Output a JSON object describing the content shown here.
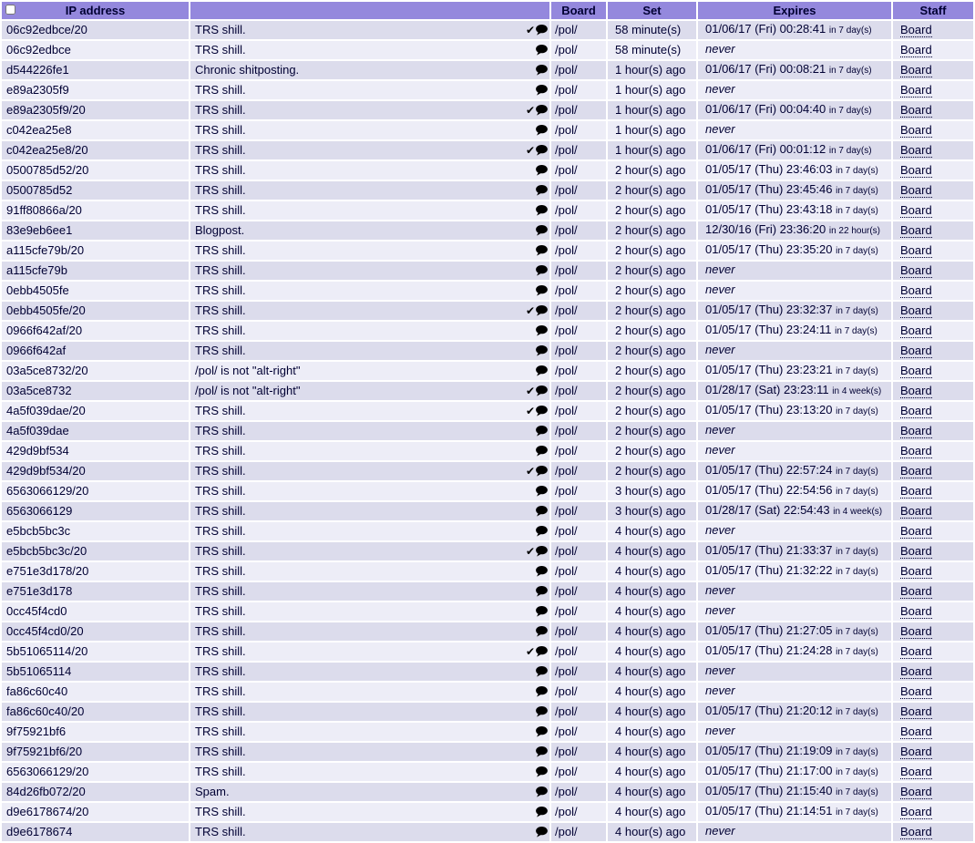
{
  "colors": {
    "header_bg": "#9488dd",
    "row_odd": "#dcdcec",
    "row_even": "#ededf7",
    "text": "#000033",
    "page_bg": "#ffffff"
  },
  "table": {
    "columns": [
      "IP address",
      "",
      "Board",
      "Set",
      "Expires",
      "Staff"
    ],
    "select_all_checked": false
  },
  "icons": {
    "seen_check": "checkmark-icon",
    "message": "speech-bubble-icon"
  },
  "rows": [
    {
      "ip": "06c92edbce/20",
      "reason": "TRS shill.",
      "check": true,
      "board": "/pol/",
      "set": "58 minute(s)",
      "expires": "01/06/17 (Fri) 00:28:41",
      "note": "in 7 day(s)",
      "staff": "Board"
    },
    {
      "ip": "06c92edbce",
      "reason": "TRS shill.",
      "check": false,
      "board": "/pol/",
      "set": "58 minute(s)",
      "expires": "never",
      "note": "",
      "staff": "Board"
    },
    {
      "ip": "d544226fe1",
      "reason": "Chronic shitposting.",
      "check": false,
      "board": "/pol/",
      "set": "1 hour(s) ago",
      "expires": "01/06/17 (Fri) 00:08:21",
      "note": "in 7 day(s)",
      "staff": "Board"
    },
    {
      "ip": "e89a2305f9",
      "reason": "TRS shill.",
      "check": false,
      "board": "/pol/",
      "set": "1 hour(s) ago",
      "expires": "never",
      "note": "",
      "staff": "Board"
    },
    {
      "ip": "e89a2305f9/20",
      "reason": "TRS shill.",
      "check": true,
      "board": "/pol/",
      "set": "1 hour(s) ago",
      "expires": "01/06/17 (Fri) 00:04:40",
      "note": "in 7 day(s)",
      "staff": "Board"
    },
    {
      "ip": "c042ea25e8",
      "reason": "TRS shill.",
      "check": false,
      "board": "/pol/",
      "set": "1 hour(s) ago",
      "expires": "never",
      "note": "",
      "staff": "Board"
    },
    {
      "ip": "c042ea25e8/20",
      "reason": "TRS shill.",
      "check": true,
      "board": "/pol/",
      "set": "1 hour(s) ago",
      "expires": "01/06/17 (Fri) 00:01:12",
      "note": "in 7 day(s)",
      "staff": "Board"
    },
    {
      "ip": "0500785d52/20",
      "reason": "TRS shill.",
      "check": false,
      "board": "/pol/",
      "set": "2 hour(s) ago",
      "expires": "01/05/17 (Thu) 23:46:03",
      "note": "in 7 day(s)",
      "staff": "Board"
    },
    {
      "ip": "0500785d52",
      "reason": "TRS shill.",
      "check": false,
      "board": "/pol/",
      "set": "2 hour(s) ago",
      "expires": "01/05/17 (Thu) 23:45:46",
      "note": "in 7 day(s)",
      "staff": "Board"
    },
    {
      "ip": "91ff80866a/20",
      "reason": "TRS shill.",
      "check": false,
      "board": "/pol/",
      "set": "2 hour(s) ago",
      "expires": "01/05/17 (Thu) 23:43:18",
      "note": "in 7 day(s)",
      "staff": "Board"
    },
    {
      "ip": "83e9eb6ee1",
      "reason": "Blogpost.",
      "check": false,
      "board": "/pol/",
      "set": "2 hour(s) ago",
      "expires": "12/30/16 (Fri) 23:36:20",
      "note": "in 22 hour(s)",
      "staff": "Board"
    },
    {
      "ip": "a115cfe79b/20",
      "reason": "TRS shill.",
      "check": false,
      "board": "/pol/",
      "set": "2 hour(s) ago",
      "expires": "01/05/17 (Thu) 23:35:20",
      "note": "in 7 day(s)",
      "staff": "Board"
    },
    {
      "ip": "a115cfe79b",
      "reason": "TRS shill.",
      "check": false,
      "board": "/pol/",
      "set": "2 hour(s) ago",
      "expires": "never",
      "note": "",
      "staff": "Board"
    },
    {
      "ip": "0ebb4505fe",
      "reason": "TRS shill.",
      "check": false,
      "board": "/pol/",
      "set": "2 hour(s) ago",
      "expires": "never",
      "note": "",
      "staff": "Board"
    },
    {
      "ip": "0ebb4505fe/20",
      "reason": "TRS shill.",
      "check": true,
      "board": "/pol/",
      "set": "2 hour(s) ago",
      "expires": "01/05/17 (Thu) 23:32:37",
      "note": "in 7 day(s)",
      "staff": "Board"
    },
    {
      "ip": "0966f642af/20",
      "reason": "TRS shill.",
      "check": false,
      "board": "/pol/",
      "set": "2 hour(s) ago",
      "expires": "01/05/17 (Thu) 23:24:11",
      "note": "in 7 day(s)",
      "staff": "Board"
    },
    {
      "ip": "0966f642af",
      "reason": "TRS shill.",
      "check": false,
      "board": "/pol/",
      "set": "2 hour(s) ago",
      "expires": "never",
      "note": "",
      "staff": "Board"
    },
    {
      "ip": "03a5ce8732/20",
      "reason": "/pol/ is not \"alt-right\"",
      "check": false,
      "board": "/pol/",
      "set": "2 hour(s) ago",
      "expires": "01/05/17 (Thu) 23:23:21",
      "note": "in 7 day(s)",
      "staff": "Board"
    },
    {
      "ip": "03a5ce8732",
      "reason": "/pol/ is not \"alt-right\"",
      "check": true,
      "board": "/pol/",
      "set": "2 hour(s) ago",
      "expires": "01/28/17 (Sat) 23:23:11",
      "note": "in 4 week(s)",
      "staff": "Board"
    },
    {
      "ip": "4a5f039dae/20",
      "reason": "TRS shill.",
      "check": true,
      "board": "/pol/",
      "set": "2 hour(s) ago",
      "expires": "01/05/17 (Thu) 23:13:20",
      "note": "in 7 day(s)",
      "staff": "Board"
    },
    {
      "ip": "4a5f039dae",
      "reason": "TRS shill.",
      "check": false,
      "board": "/pol/",
      "set": "2 hour(s) ago",
      "expires": "never",
      "note": "",
      "staff": "Board"
    },
    {
      "ip": "429d9bf534",
      "reason": "TRS shill.",
      "check": false,
      "board": "/pol/",
      "set": "2 hour(s) ago",
      "expires": "never",
      "note": "",
      "staff": "Board"
    },
    {
      "ip": "429d9bf534/20",
      "reason": "TRS shill.",
      "check": true,
      "board": "/pol/",
      "set": "2 hour(s) ago",
      "expires": "01/05/17 (Thu) 22:57:24",
      "note": "in 7 day(s)",
      "staff": "Board"
    },
    {
      "ip": "6563066129/20",
      "reason": "TRS shill.",
      "check": false,
      "board": "/pol/",
      "set": "3 hour(s) ago",
      "expires": "01/05/17 (Thu) 22:54:56",
      "note": "in 7 day(s)",
      "staff": "Board"
    },
    {
      "ip": "6563066129",
      "reason": "TRS shill.",
      "check": false,
      "board": "/pol/",
      "set": "3 hour(s) ago",
      "expires": "01/28/17 (Sat) 22:54:43",
      "note": "in 4 week(s)",
      "staff": "Board"
    },
    {
      "ip": "e5bcb5bc3c",
      "reason": "TRS shill.",
      "check": false,
      "board": "/pol/",
      "set": "4 hour(s) ago",
      "expires": "never",
      "note": "",
      "staff": "Board"
    },
    {
      "ip": "e5bcb5bc3c/20",
      "reason": "TRS shill.",
      "check": true,
      "board": "/pol/",
      "set": "4 hour(s) ago",
      "expires": "01/05/17 (Thu) 21:33:37",
      "note": "in 7 day(s)",
      "staff": "Board"
    },
    {
      "ip": "e751e3d178/20",
      "reason": "TRS shill.",
      "check": false,
      "board": "/pol/",
      "set": "4 hour(s) ago",
      "expires": "01/05/17 (Thu) 21:32:22",
      "note": "in 7 day(s)",
      "staff": "Board"
    },
    {
      "ip": "e751e3d178",
      "reason": "TRS shill.",
      "check": false,
      "board": "/pol/",
      "set": "4 hour(s) ago",
      "expires": "never",
      "note": "",
      "staff": "Board"
    },
    {
      "ip": "0cc45f4cd0",
      "reason": "TRS shill.",
      "check": false,
      "board": "/pol/",
      "set": "4 hour(s) ago",
      "expires": "never",
      "note": "",
      "staff": "Board"
    },
    {
      "ip": "0cc45f4cd0/20",
      "reason": "TRS shill.",
      "check": false,
      "board": "/pol/",
      "set": "4 hour(s) ago",
      "expires": "01/05/17 (Thu) 21:27:05",
      "note": "in 7 day(s)",
      "staff": "Board"
    },
    {
      "ip": "5b51065114/20",
      "reason": "TRS shill.",
      "check": true,
      "board": "/pol/",
      "set": "4 hour(s) ago",
      "expires": "01/05/17 (Thu) 21:24:28",
      "note": "in 7 day(s)",
      "staff": "Board"
    },
    {
      "ip": "5b51065114",
      "reason": "TRS shill.",
      "check": false,
      "board": "/pol/",
      "set": "4 hour(s) ago",
      "expires": "never",
      "note": "",
      "staff": "Board"
    },
    {
      "ip": "fa86c60c40",
      "reason": "TRS shill.",
      "check": false,
      "board": "/pol/",
      "set": "4 hour(s) ago",
      "expires": "never",
      "note": "",
      "staff": "Board"
    },
    {
      "ip": "fa86c60c40/20",
      "reason": "TRS shill.",
      "check": false,
      "board": "/pol/",
      "set": "4 hour(s) ago",
      "expires": "01/05/17 (Thu) 21:20:12",
      "note": "in 7 day(s)",
      "staff": "Board"
    },
    {
      "ip": "9f75921bf6",
      "reason": "TRS shill.",
      "check": false,
      "board": "/pol/",
      "set": "4 hour(s) ago",
      "expires": "never",
      "note": "",
      "staff": "Board"
    },
    {
      "ip": "9f75921bf6/20",
      "reason": "TRS shill.",
      "check": false,
      "board": "/pol/",
      "set": "4 hour(s) ago",
      "expires": "01/05/17 (Thu) 21:19:09",
      "note": "in 7 day(s)",
      "staff": "Board"
    },
    {
      "ip": "6563066129/20",
      "reason": "TRS shill.",
      "check": false,
      "board": "/pol/",
      "set": "4 hour(s) ago",
      "expires": "01/05/17 (Thu) 21:17:00",
      "note": "in 7 day(s)",
      "staff": "Board"
    },
    {
      "ip": "84d26fb072/20",
      "reason": "Spam.",
      "check": false,
      "board": "/pol/",
      "set": "4 hour(s) ago",
      "expires": "01/05/17 (Thu) 21:15:40",
      "note": "in 7 day(s)",
      "staff": "Board"
    },
    {
      "ip": "d9e6178674/20",
      "reason": "TRS shill.",
      "check": false,
      "board": "/pol/",
      "set": "4 hour(s) ago",
      "expires": "01/05/17 (Thu) 21:14:51",
      "note": "in 7 day(s)",
      "staff": "Board"
    },
    {
      "ip": "d9e6178674",
      "reason": "TRS shill.",
      "check": false,
      "board": "/pol/",
      "set": "4 hour(s) ago",
      "expires": "never",
      "note": "",
      "staff": "Board"
    }
  ]
}
